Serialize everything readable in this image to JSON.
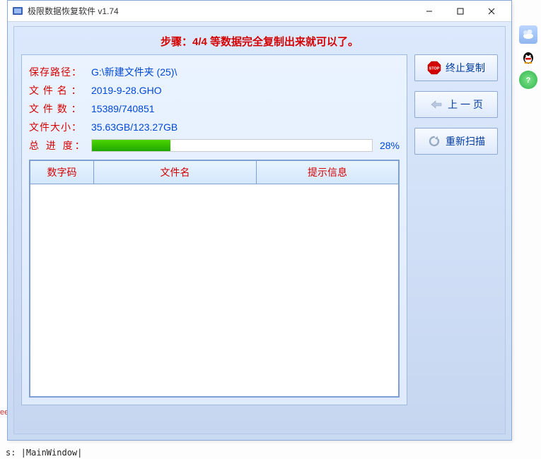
{
  "window": {
    "title": "极限数据恢复软件 v1.74"
  },
  "step": "步骤：4/4 等数据完全复制出来就可以了。",
  "labels": {
    "save_path": "保存路径：",
    "file_name": "文 件 名 ：",
    "file_count": "文 件 数 ：",
    "file_size": "文件大小：",
    "progress": "总 进 度："
  },
  "values": {
    "save_path": "G:\\新建文件夹 (25)\\",
    "file_name": "2019-9-28.GHO",
    "file_count": "15389/740851",
    "file_size": "35.63GB/123.27GB",
    "progress_pct": "28%"
  },
  "table": {
    "headers": {
      "code": "数字码",
      "name": "文件名",
      "info": "提示信息"
    }
  },
  "buttons": {
    "stop": "终止复制",
    "prev": "上 一 页",
    "rescan": "重新扫描"
  },
  "bg": {
    "hint2": "ee",
    "hint3": "s: |MainWindow|"
  }
}
